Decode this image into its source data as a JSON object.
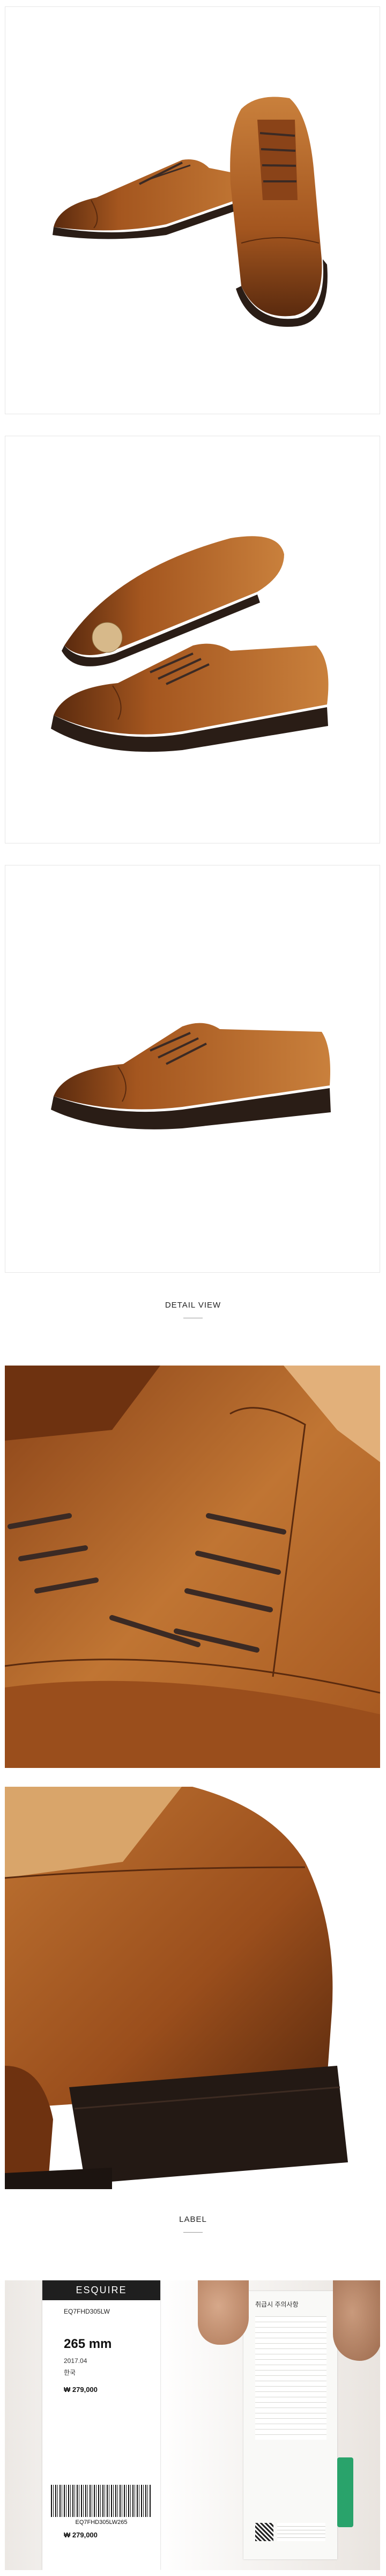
{
  "sections": {
    "detail_title": "DETAIL VIEW",
    "label_title": "LABEL"
  },
  "label": {
    "brand": "ESQUIRE",
    "size": "265 mm",
    "price": "279,000",
    "price_bottom": "279,000",
    "year": "2017.04",
    "origin": "한국",
    "model": "EQ7FHD305LW",
    "barcode_text": "EQ7FHD305LW265",
    "care_title": "취급시 주의사항"
  },
  "colors": {
    "leather": "#a4561f",
    "leather_dark": "#5a2a0e",
    "sole": "#2a1d16",
    "lace": "#3b2a24"
  }
}
